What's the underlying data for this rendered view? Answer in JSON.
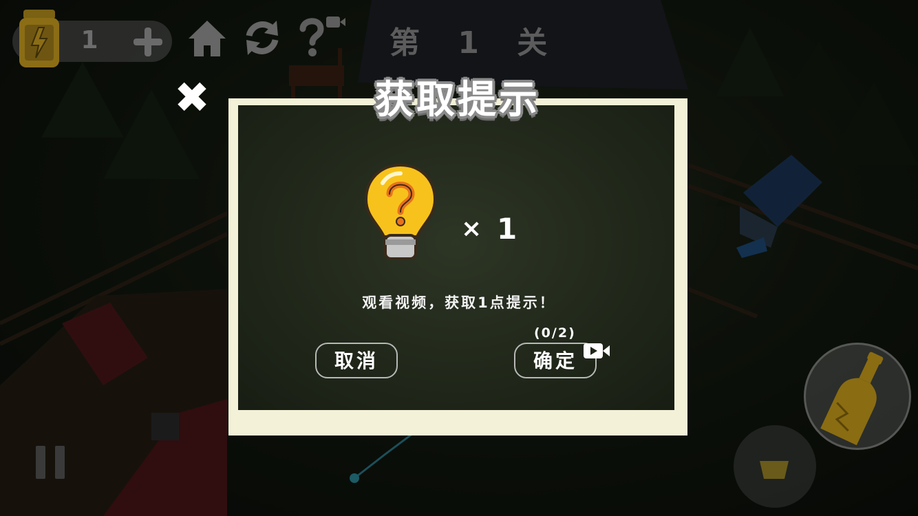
{
  "hud": {
    "energy_count": "1",
    "level_title": "第 1 关"
  },
  "modal": {
    "title": "获取提示",
    "reward_multiplier": "×",
    "reward_count": "1",
    "message": "观看视频，获取1点提示！",
    "cancel_label": "取消",
    "confirm_label": "确定",
    "video_quota": "(0/2)"
  },
  "icons": {
    "energy": "energy-jar-icon",
    "add": "plus-icon",
    "home": "home-icon",
    "restart": "refresh-icon",
    "hint_video": "question-video-icon",
    "close": "close-icon",
    "hint": "lightbulb-question-icon",
    "video": "video-camera-icon",
    "bottle": "bottle-icon",
    "pause": "pause-icon"
  },
  "colors": {
    "frame": "#f3f1d7",
    "board": "#1f2619",
    "bulb_yellow": "#f8c21c",
    "question_orange": "#e8731b"
  }
}
